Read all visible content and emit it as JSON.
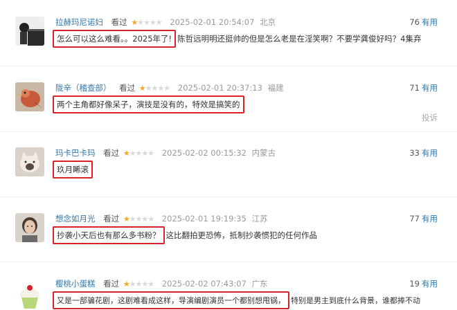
{
  "common": {
    "watched_label": "看过",
    "votes_unit": "有用",
    "rating_stars": 1,
    "max_stars": 5
  },
  "reviews": [
    {
      "username": "拉赫玛尼诺妇",
      "time": "2025-02-01 20:54:07",
      "location": "北京",
      "votes": "76",
      "comment_highlight": "怎么可以这么难看。。2025年了!",
      "comment_rest": "陈哲远明明还挺帅的但是怎么老是在淫笑啊？不要学龚俊好吗？4集弃",
      "avatar_icon": "woman-piano-avatar"
    },
    {
      "username": "陇辛（稽查部）",
      "time": "2025-02-01 20:37:13",
      "location": "福建",
      "votes": "71",
      "comment_highlight": "两个主角都好像呆子，演技是没有的，特效是搞笑的",
      "comment_rest": "",
      "report": "投诉",
      "avatar_icon": "bird-avatar"
    },
    {
      "username": "玛卡巴卡玛",
      "time": "2025-02-02 00:15:32",
      "location": "内蒙古",
      "votes": "33",
      "comment_highlight": "玖月睎滚",
      "comment_rest": "",
      "avatar_icon": "cat-avatar"
    },
    {
      "username": "想念如月光",
      "time": "2025-02-01 19:19:35",
      "location": "江苏",
      "votes": "77",
      "comment_highlight": "抄袭小天后也有那么多书粉？",
      "comment_rest": "这比翻拍更恐怖，抵制抄袭惯犯的任何作品",
      "avatar_icon": "portrait-avatar"
    },
    {
      "username": "樱桃小蛋糕",
      "time": "2025-02-02 07:43:07",
      "location": "广东",
      "votes": "19",
      "comment_highlight": "又是一部骗花剧，这剧难看成这样，导演编剧演员一个都别想甩锅，",
      "comment_rest": "特别是男主到底什么背景，谁都捧不动",
      "avatar_icon": "cupcake-avatar"
    }
  ]
}
